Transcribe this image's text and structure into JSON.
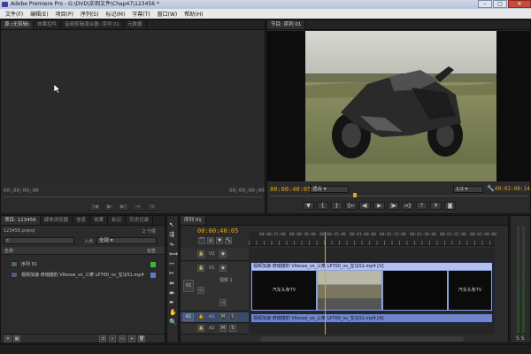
{
  "window": {
    "title": "Adobe Premiere Pro - G:\\DVD\\实例文件\\Chap47\\123456 *",
    "buttons": {
      "minimize": "–",
      "maximize": "□",
      "close": "✕"
    }
  },
  "menu": [
    "文件(F)",
    "编辑(E)",
    "项目(P)",
    "序列(S)",
    "标记(M)",
    "字幕(T)",
    "窗口(W)",
    "帮助(H)"
  ],
  "source_monitor": {
    "tabs": [
      "源:(无剪辑)",
      "效果控件",
      "音频剪辑混合器: 序列 01",
      "元数据"
    ],
    "timecode_left": "00;00;00;00",
    "timecode_right": "00;00;00;00"
  },
  "program_monitor": {
    "tab": "节目: 序列 01",
    "timecode_current": "00:00:40:05",
    "fit_label": "适合",
    "resolution_label": "1/2",
    "timecode_duration": "00:02:08:14"
  },
  "project_panel": {
    "tabs": [
      "项目: 123456",
      "媒体浏览器",
      "信息",
      "效果",
      "标记",
      "历史记录"
    ],
    "project_file": "123456.prproj",
    "item_count": "2 个项",
    "search_placeholder": "",
    "in_label": "入点:",
    "in_value": "全部",
    "col_name": "名称",
    "col_label": "标签",
    "items": [
      {
        "name": "序列 01",
        "color": "#3cb83c"
      },
      {
        "name": "视频加速-奇瑞捷豹 Vitesse_vs_三摩 LP700_vs_宝马S1.mp4",
        "color": "#4f7fd0"
      }
    ]
  },
  "timeline": {
    "tab": "序列 01",
    "timecode": "00:00:40:05",
    "ruler_labels": [
      "00:00:15:00",
      "00:00:30:00",
      "00:00:45:00",
      "00:01:00:00",
      "00:01:15:00",
      "00:01:30:00",
      "00:01:45:00",
      "00:02:00:00"
    ],
    "tracks": {
      "v2": "V2",
      "v1_target": "V1",
      "v1": "V1",
      "v1_name": "视频 1",
      "a1_target": "A1",
      "a1": "A1",
      "a2": "A2",
      "mute": "M",
      "solo": "S"
    },
    "clip_video_label": "视频加速-奇瑞捷豹 Vitesse_vs_三摩 LP700_vs_宝马S1.mp4 [V]",
    "clip_audio_label": "视频加速-奇瑞捷豹 Vitesse_vs_三摩 LP700_vs_宝马S1.mp4 [A]",
    "thumb_text": "汽车头条TV",
    "playhead_fraction": 0.31
  },
  "colors": {
    "timecode": "#e8a317",
    "video_clip": "#8ea0d8",
    "audio_clip": "#6f86c8"
  }
}
